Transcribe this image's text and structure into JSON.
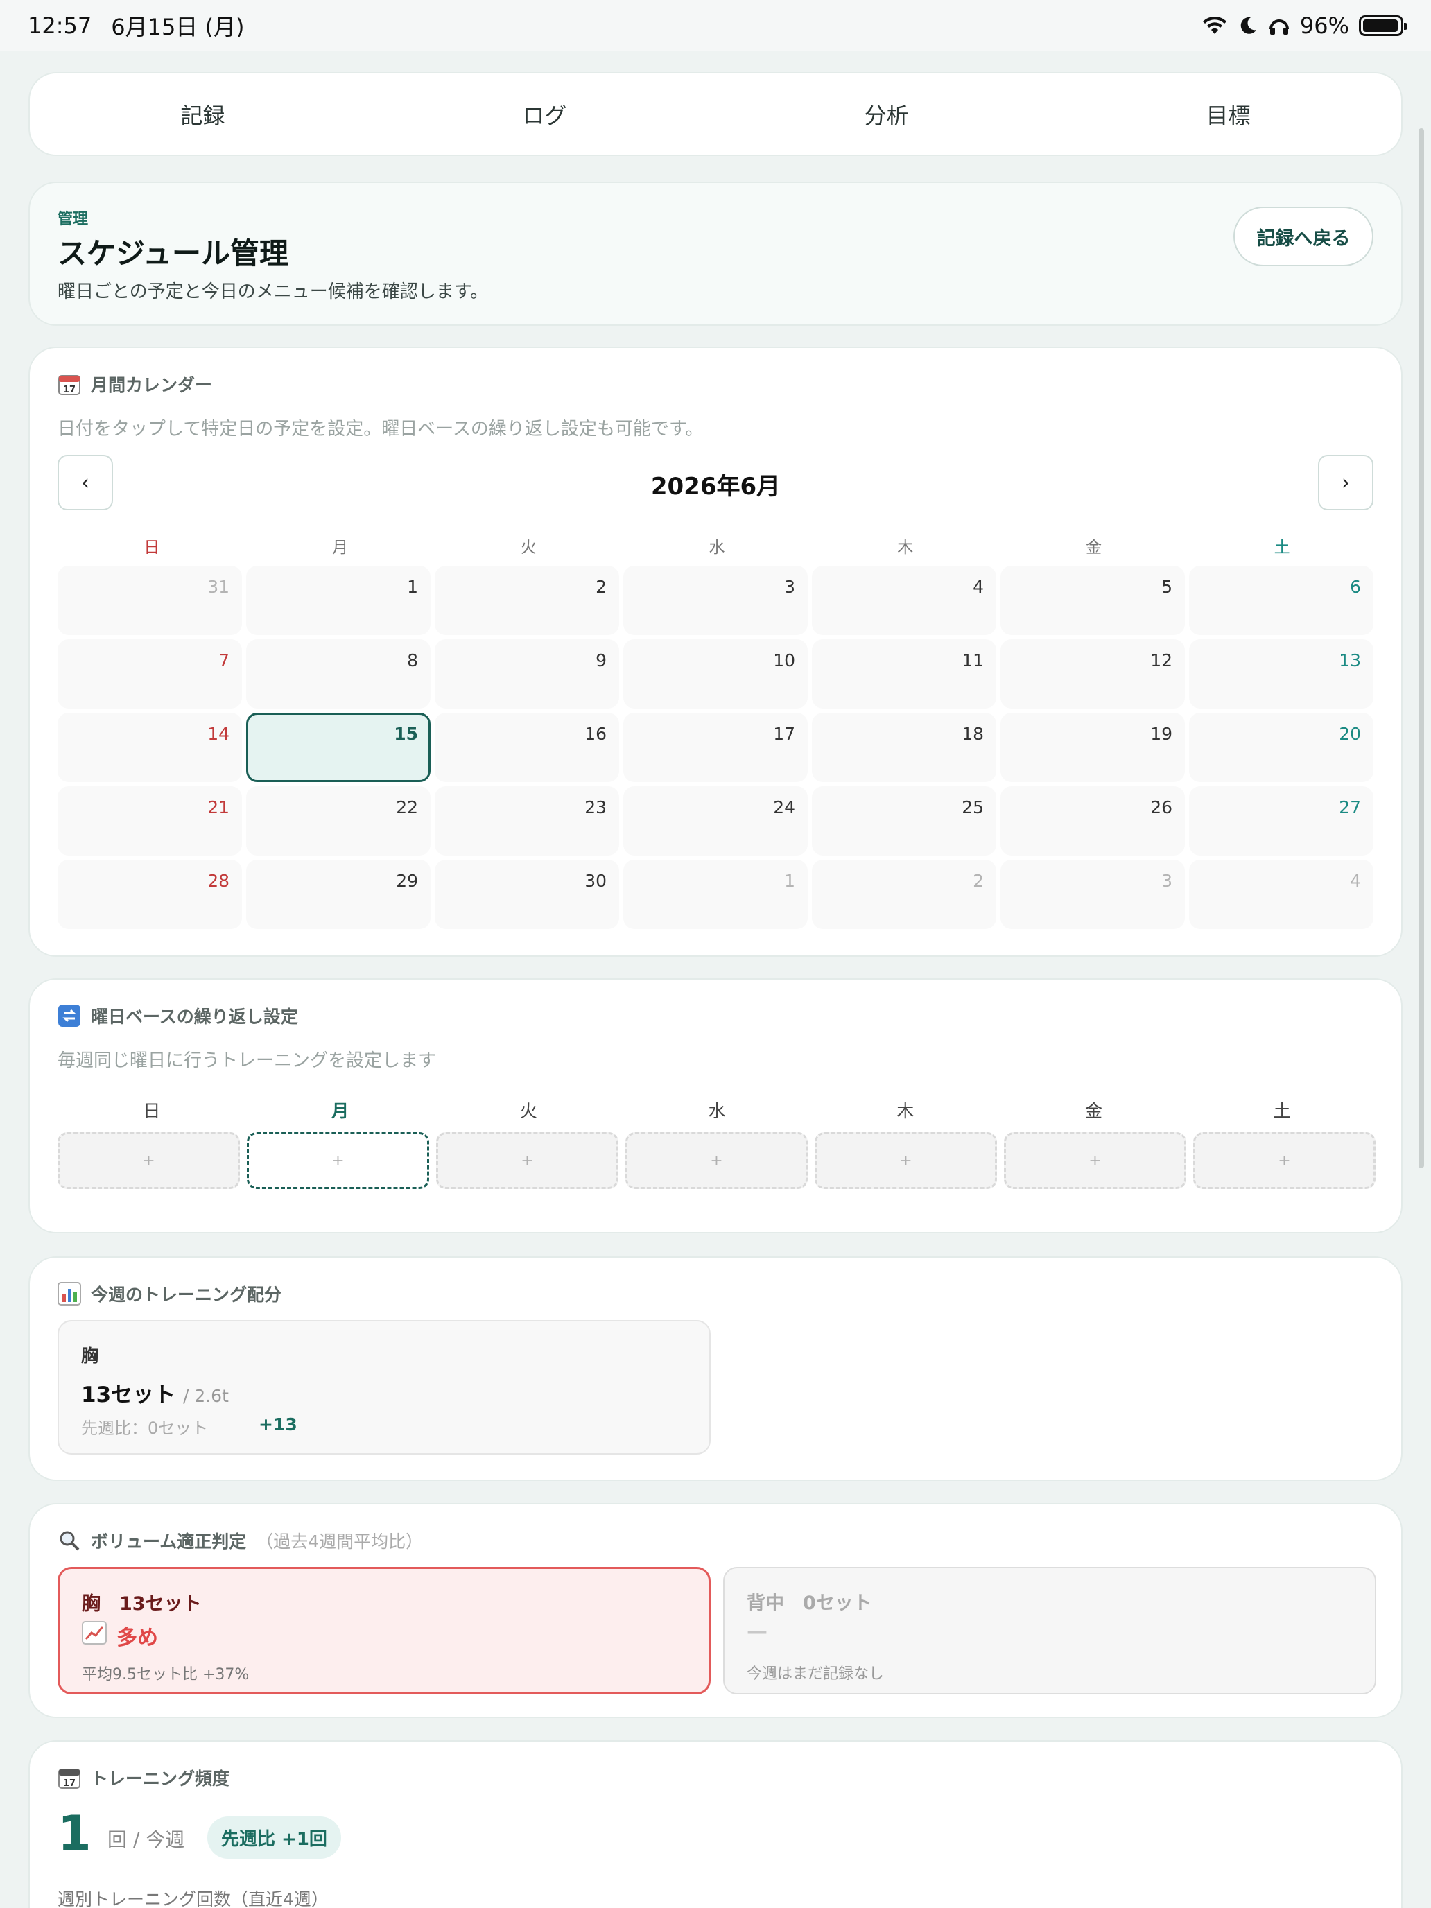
{
  "status": {
    "time": "12:57",
    "date": "6月15日 (月)",
    "battery": "96%"
  },
  "tabs": [
    "記録",
    "ログ",
    "分析",
    "目標"
  ],
  "header": {
    "eyebrow": "管理",
    "title": "スケジュール管理",
    "subtitle": "曜日ごとの予定と今日のメニュー候補を確認します。",
    "back_button": "記録へ戻る"
  },
  "calendar": {
    "icon": "calendar-icon",
    "title": "月間カレンダー",
    "description": "日付をタップして特定日の予定を設定。曜日ベースの繰り返し設定も可能です。",
    "month_title": "2026年6月",
    "prev_label": "‹",
    "next_label": "›",
    "weekdays": [
      "日",
      "月",
      "火",
      "水",
      "木",
      "金",
      "土"
    ],
    "days": [
      {
        "n": "31",
        "other": true
      },
      {
        "n": "1"
      },
      {
        "n": "2"
      },
      {
        "n": "3"
      },
      {
        "n": "4"
      },
      {
        "n": "5"
      },
      {
        "n": "6"
      },
      {
        "n": "7"
      },
      {
        "n": "8"
      },
      {
        "n": "9"
      },
      {
        "n": "10"
      },
      {
        "n": "11"
      },
      {
        "n": "12"
      },
      {
        "n": "13"
      },
      {
        "n": "14"
      },
      {
        "n": "15",
        "today": true
      },
      {
        "n": "16"
      },
      {
        "n": "17"
      },
      {
        "n": "18"
      },
      {
        "n": "19"
      },
      {
        "n": "20"
      },
      {
        "n": "21"
      },
      {
        "n": "22"
      },
      {
        "n": "23"
      },
      {
        "n": "24"
      },
      {
        "n": "25"
      },
      {
        "n": "26"
      },
      {
        "n": "27"
      },
      {
        "n": "28"
      },
      {
        "n": "29"
      },
      {
        "n": "30"
      },
      {
        "n": "1",
        "other": true
      },
      {
        "n": "2",
        "other": true
      },
      {
        "n": "3",
        "other": true
      },
      {
        "n": "4",
        "other": true
      }
    ]
  },
  "recurring": {
    "icon": "repeat-icon",
    "title": "曜日ベースの繰り返し設定",
    "description": "毎週同じ曜日に行うトレーニングを設定します",
    "weekdays": [
      "日",
      "月",
      "火",
      "水",
      "木",
      "金",
      "土"
    ],
    "active_index": 1,
    "slot_label": "+"
  },
  "distribution": {
    "icon": "bar-chart-icon",
    "title": "今週のトレーニング配分",
    "part": "胸",
    "sets": "13セット",
    "tonnage": "/ 2.6t",
    "compare": "先週比：0セット",
    "delta": "+13"
  },
  "volume": {
    "icon": "magnifier-icon",
    "title": "ボリューム適正判定",
    "title_note": "（過去4週間平均比）",
    "items": [
      {
        "head": "胸　13セット",
        "level": "多め",
        "foot": "平均9.5セット比 +37%"
      },
      {
        "head": "背中　0セット",
        "level": "—",
        "foot": "今週はまだ記録なし"
      }
    ]
  },
  "frequency": {
    "icon": "calendar-icon",
    "title": "トレーニング頻度",
    "count": "1",
    "unit": "回 / 今週",
    "compare": "先週比 +1回",
    "subtitle": "週別トレーニング回数（直近4週）"
  },
  "colors": {
    "accent": "#1b6d60",
    "sunday": "#c23a3a",
    "saturday": "#1b8a83",
    "danger": "#e04848"
  }
}
